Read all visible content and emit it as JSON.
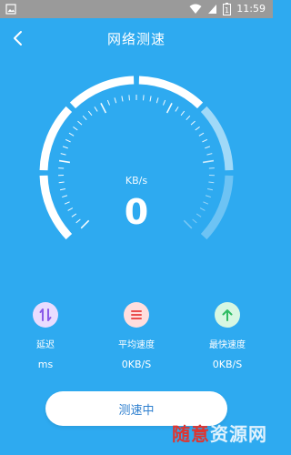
{
  "status_bar": {
    "time": "11:59",
    "battery_level": "1"
  },
  "header": {
    "title": "网络测速"
  },
  "gauge": {
    "unit": "KB/s",
    "speed": "0",
    "progress_fraction": 0.0
  },
  "stats": [
    {
      "label": "延迟",
      "value": "ms",
      "icon": "latency-icon",
      "color": "#9b6cf0"
    },
    {
      "label": "平均速度",
      "value": "0KB/S",
      "icon": "menu-icon",
      "color": "#ef5a5a"
    },
    {
      "label": "最快速度",
      "value": "0KB/S",
      "icon": "arrow-up-icon",
      "color": "#3cc96f"
    }
  ],
  "action": {
    "button_label": "测速中"
  },
  "watermark": {
    "red_part": "随意",
    "white_part": "资源网"
  },
  "colors": {
    "background": "#2eaaf0",
    "button_text": "#2e7fcf"
  }
}
